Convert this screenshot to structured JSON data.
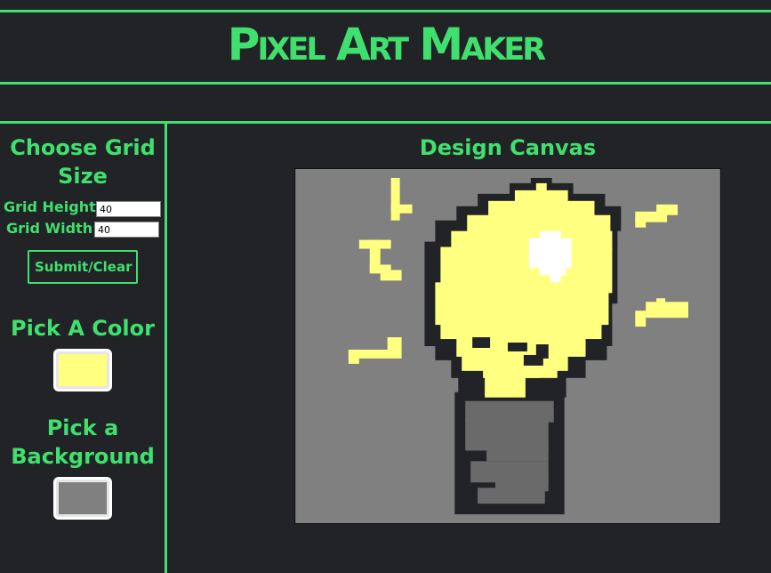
{
  "header": {
    "title": "Pixel Art Maker"
  },
  "sidebar": {
    "grid_heading": "Choose Grid Size",
    "height_label": "Grid Height:",
    "height_value": "40",
    "width_label": "Grid Width:",
    "width_value": "40",
    "submit_label": "Submit/Clear",
    "color_heading": "Pick A Color",
    "color_value": "#ffff80",
    "background_heading": "Pick a Background",
    "background_value": "#808080"
  },
  "canvas": {
    "title": "Design Canvas",
    "colors": {
      "yellow": "#ffff80",
      "dark": "#222326",
      "gray": "#6a6a6a",
      "white": "#ffffff",
      "bg": "#808080"
    }
  }
}
